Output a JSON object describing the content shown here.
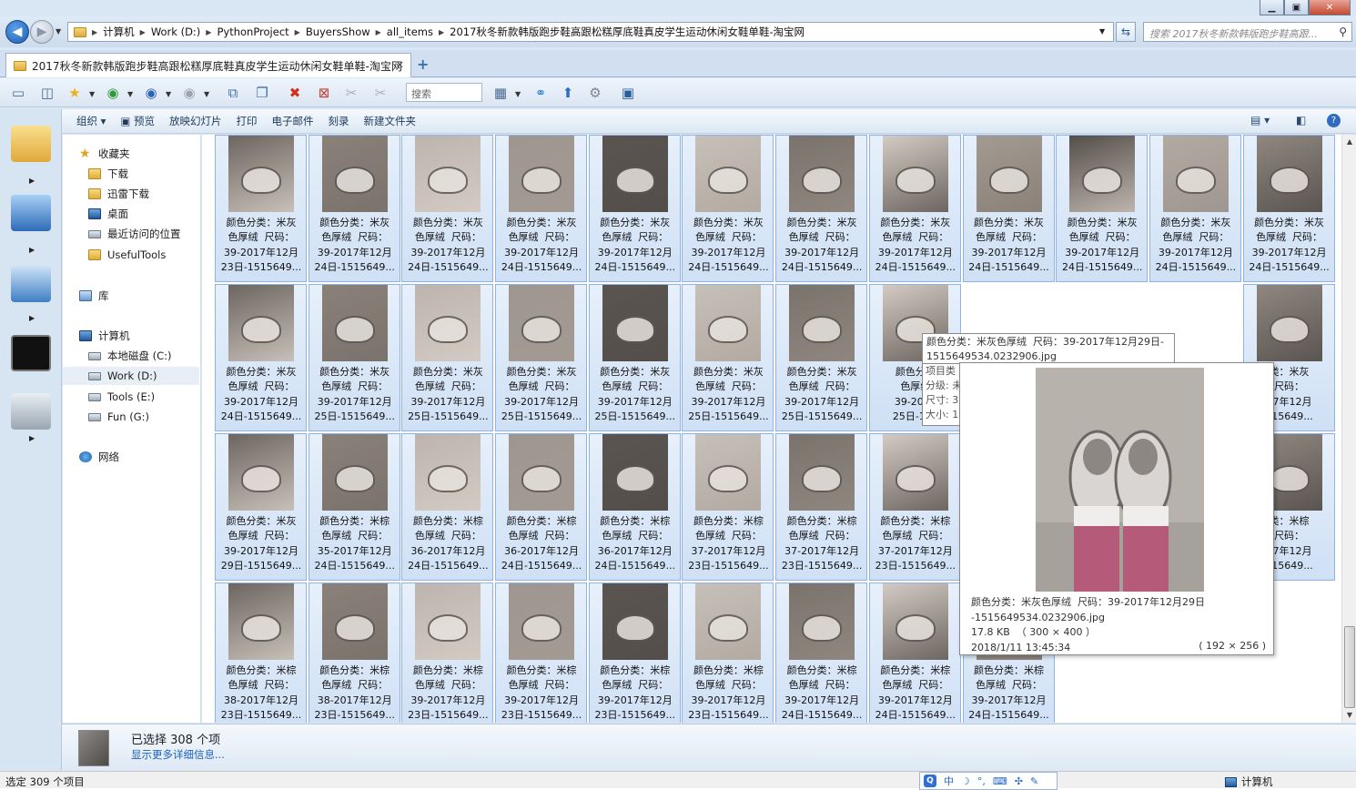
{
  "window": {
    "caption_minimize": "▁",
    "caption_maximize": "▣",
    "caption_close": "✕"
  },
  "address": {
    "crumbs": [
      "计算机",
      "Work (D:)",
      "PythonProject",
      "BuyersShow",
      "all_items",
      "2017秋冬新款韩版跑步鞋高跟松糕厚底鞋真皮学生运动休闲女鞋单鞋-淘宝网"
    ],
    "search_placeholder": "搜索 2017秋冬新款韩版跑步鞋高跟..."
  },
  "tab": {
    "title": "2017秋冬新款韩版跑步鞋高跟松糕厚底鞋真皮学生运动休闲女鞋单鞋-淘宝网",
    "close": "✕",
    "add": "+"
  },
  "toolbar": {
    "search_placeholder": "搜索"
  },
  "commands": [
    "组织 ▾",
    "预览",
    "放映幻灯片",
    "打印",
    "电子邮件",
    "刻录",
    "新建文件夹"
  ],
  "nav": {
    "favorites": "收藏夹",
    "downloads": "下载",
    "thunder": "迅雷下载",
    "desktop": "桌面",
    "recent": "最近访问的位置",
    "usefultools": "UsefulTools",
    "libraries": "库",
    "computer": "计算机",
    "drive_c": "本地磁盘 (C:)",
    "drive_d": "Work (D:)",
    "drive_e": "Tools (E:)",
    "drive_g": "Fun (G:)",
    "network": "网络"
  },
  "files": [
    {
      "c": "颜色分类：米灰\n色厚绒  尺码：\n39-2017年12月\n23日-1515649..."
    },
    {
      "c": "颜色分类：米灰\n色厚绒  尺码：\n39-2017年12月\n24日-1515649..."
    },
    {
      "c": "颜色分类：米灰\n色厚绒  尺码：\n39-2017年12月\n24日-1515649..."
    },
    {
      "c": "颜色分类：米灰\n色厚绒  尺码：\n39-2017年12月\n24日-1515649..."
    },
    {
      "c": "颜色分类：米灰\n色厚绒  尺码：\n39-2017年12月\n24日-1515649..."
    },
    {
      "c": "颜色分类：米灰\n色厚绒  尺码：\n39-2017年12月\n24日-1515649..."
    },
    {
      "c": "颜色分类：米灰\n色厚绒  尺码：\n39-2017年12月\n24日-1515649..."
    },
    {
      "c": "颜色分类：米灰\n色厚绒  尺码：\n39-2017年12月\n24日-1515649..."
    },
    {
      "c": "颜色分类：米灰\n色厚绒  尺码：\n39-2017年12月\n24日-1515649..."
    },
    {
      "c": "颜色分类：米灰\n色厚绒  尺码：\n39-2017年12月\n24日-1515649..."
    },
    {
      "c": "颜色分类：米灰\n色厚绒  尺码：\n39-2017年12月\n24日-1515649..."
    },
    {
      "c": "颜色分类：米灰\n色厚绒  尺码：\n39-2017年12月\n24日-1515649..."
    },
    {
      "c": "颜色分类：米灰\n色厚绒  尺码：\n39-2017年12月\n24日-1515649..."
    },
    {
      "c": "颜色分类：米灰\n色厚绒  尺码：\n39-2017年12月\n25日-1515649..."
    },
    {
      "c": "颜色分类：米灰\n色厚绒  尺码：\n39-2017年12月\n25日-1515649..."
    },
    {
      "c": "颜色分类：米灰\n色厚绒  尺码：\n39-2017年12月\n25日-1515649..."
    },
    {
      "c": "颜色分类：米灰\n色厚绒  尺码：\n39-2017年12月\n25日-1515649..."
    },
    {
      "c": "颜色分类：米灰\n色厚绒  尺码：\n39-2017年12月\n25日-1515649..."
    },
    {
      "c": "颜色分类：米灰\n色厚绒  尺码：\n39-2017年12月\n25日-1515649..."
    },
    {
      "c": "颜色分类\n色厚绒\n39-2017\n25日-151"
    },
    {
      "c": ""
    },
    {
      "c": ""
    },
    {
      "c": ""
    },
    {
      "c": "类：米灰\n尺码：\n17年12月\n515649..."
    },
    {
      "c": "颜色分类：米灰\n色厚绒  尺码：\n39-2017年12月\n29日-1515649..."
    },
    {
      "c": "颜色分类：米棕\n色厚绒  尺码：\n35-2017年12月\n24日-1515649..."
    },
    {
      "c": "颜色分类：米棕\n色厚绒  尺码：\n36-2017年12月\n24日-1515649..."
    },
    {
      "c": "颜色分类：米棕\n色厚绒  尺码：\n36-2017年12月\n24日-1515649..."
    },
    {
      "c": "颜色分类：米棕\n色厚绒  尺码：\n36-2017年12月\n24日-1515649..."
    },
    {
      "c": "颜色分类：米棕\n色厚绒  尺码：\n37-2017年12月\n23日-1515649..."
    },
    {
      "c": "颜色分类：米棕\n色厚绒  尺码：\n37-2017年12月\n23日-1515649..."
    },
    {
      "c": "颜色分类：米棕\n色厚绒  尺码：\n37-2017年12月\n23日-1515649..."
    },
    {
      "c": ""
    },
    {
      "c": ""
    },
    {
      "c": ""
    },
    {
      "c": "类：米棕\n尺码：\n17年12月\n515649..."
    },
    {
      "c": "颜色分类：米棕\n色厚绒  尺码：\n38-2017年12月\n23日-1515649..."
    },
    {
      "c": "颜色分类：米棕\n色厚绒  尺码：\n38-2017年12月\n23日-1515649..."
    },
    {
      "c": "颜色分类：米棕\n色厚绒  尺码：\n39-2017年12月\n23日-1515649..."
    },
    {
      "c": "颜色分类：米棕\n色厚绒  尺码：\n39-2017年12月\n23日-1515649..."
    },
    {
      "c": "颜色分类：米棕\n色厚绒  尺码：\n39-2017年12月\n23日-1515649..."
    },
    {
      "c": "颜色分类：米棕\n色厚绒  尺码：\n39-2017年12月\n23日-1515649..."
    },
    {
      "c": "颜色分类：米棕\n色厚绒  尺码：\n39-2017年12月\n24日-1515649..."
    },
    {
      "c": "颜色分类：米棕\n色厚绒  尺码：\n39-2017年12月\n24日-1515649..."
    },
    {
      "c": "颜色分类：米棕\n色厚绒  尺码：\n39-2017年12月\n24日-1515649..."
    }
  ],
  "tooltip": {
    "name": "颜色分类：米灰色厚绒  尺码：39-2017年12月29日-\n1515649534.0232906.jpg",
    "side": "项目类\n分级: 未\n尺寸: 30\n大小: 17",
    "preview_info": "颜色分类：米灰色厚绒  尺码：39-2017年12月29日\n-1515649534.0232906.jpg\n17.8 KB  （ 300 × 400 ）\n2018/1/11 13:45:34",
    "preview_dim": "( 192 × 256 )"
  },
  "details": {
    "selected": "已选择 308 个项",
    "more": "显示更多详细信息..."
  },
  "status": {
    "left": "选定 309 个项目",
    "right": "计算机",
    "ime": [
      "中",
      "☽",
      "°,",
      "⌨",
      "✣",
      "✎"
    ]
  },
  "colors": {
    "accent": "#1d5cb0",
    "selection_fill": "#cfe0f5",
    "selection_border": "#8fb4e4",
    "link": "#1c62b9"
  }
}
